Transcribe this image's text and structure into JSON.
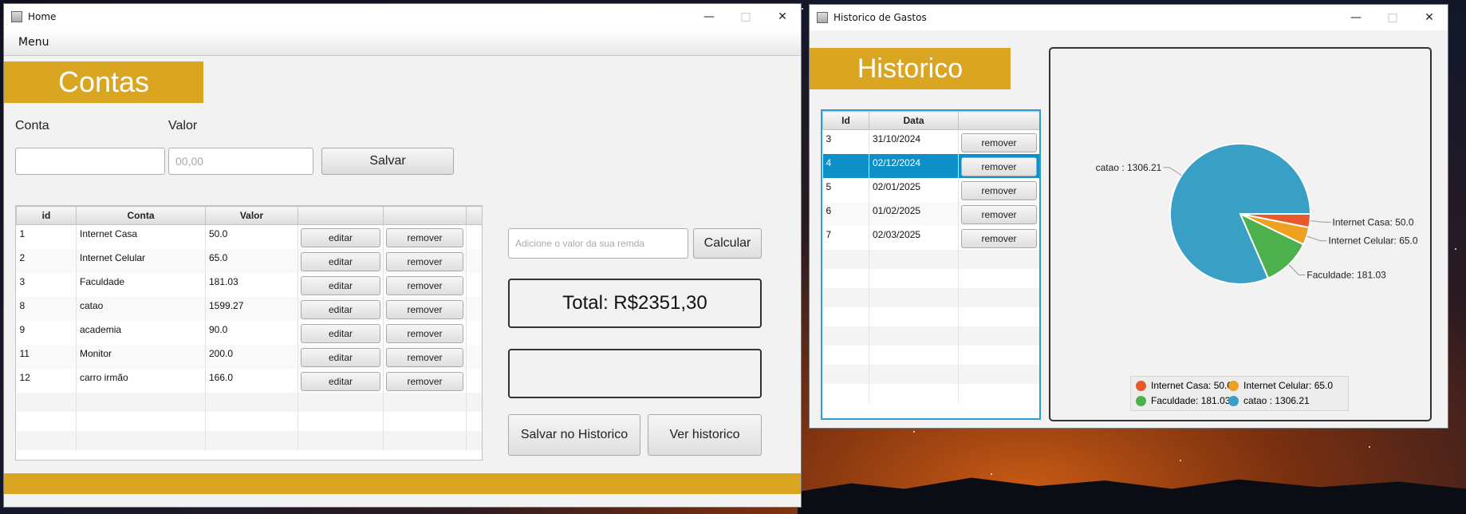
{
  "home": {
    "title": "Home",
    "menu_label": "Menu",
    "banner_title": "Contas",
    "conta_label": "Conta",
    "valor_label": "Valor",
    "conta_value": "",
    "valor_placeholder": "00,00",
    "save_label": "Salvar",
    "table": {
      "columns": [
        "id",
        "Conta",
        "Valor",
        "",
        ""
      ],
      "rows": [
        {
          "id": "1",
          "conta": "Internet Casa",
          "valor": "50.0"
        },
        {
          "id": "2",
          "conta": "Internet Celular",
          "valor": "65.0"
        },
        {
          "id": "3",
          "conta": "Faculdade",
          "valor": "181.03"
        },
        {
          "id": "8",
          "conta": "catao",
          "valor": "1599.27"
        },
        {
          "id": "9",
          "conta": "academia",
          "valor": "90.0"
        },
        {
          "id": "11",
          "conta": "Monitor",
          "valor": "200.0"
        },
        {
          "id": "12",
          "conta": "carro irmão",
          "valor": "166.0"
        }
      ],
      "edit_label": "editar",
      "remove_label": "remover"
    },
    "renda_placeholder": "Adicione o valor da sua remda",
    "calcular_label": "Calcular",
    "total_text": "Total: R$2351,30",
    "result_text": "",
    "salvar_hist_label": "Salvar no Historico",
    "ver_hist_label": "Ver historico",
    "accent_color": "#daa520"
  },
  "hist": {
    "title": "Historico de Gastos",
    "banner_title": "Historico",
    "table": {
      "columns": [
        "Id",
        "Data",
        ""
      ],
      "rows": [
        {
          "id": "3",
          "data": "31/10/2024"
        },
        {
          "id": "4",
          "data": "02/12/2024"
        },
        {
          "id": "5",
          "data": "02/01/2025"
        },
        {
          "id": "6",
          "data": "01/02/2025"
        },
        {
          "id": "7",
          "data": "02/03/2025"
        }
      ],
      "selected_id": "4",
      "remove_label": "remover"
    }
  },
  "chart_data": {
    "type": "pie",
    "slices": [
      {
        "name": "Internet Casa",
        "value": 50.0,
        "label": "Internet Casa: 50.0",
        "color": "#e8582b"
      },
      {
        "name": "Internet Celular",
        "value": 65.0,
        "label": "Internet Celular: 65.0",
        "color": "#f0a020"
      },
      {
        "name": "Faculdade",
        "value": 181.03,
        "label": "Faculdade: 181.03",
        "color": "#4cb04c"
      },
      {
        "name": "catao",
        "value": 1306.21,
        "label": "catao : 1306.21",
        "color": "#3a9fc4"
      }
    ],
    "legend": [
      "Internet Casa: 50.0",
      "Internet Celular: 65.0",
      "Faculdade: 181.03",
      "catao : 1306.21"
    ],
    "legend_position": "bottom"
  }
}
